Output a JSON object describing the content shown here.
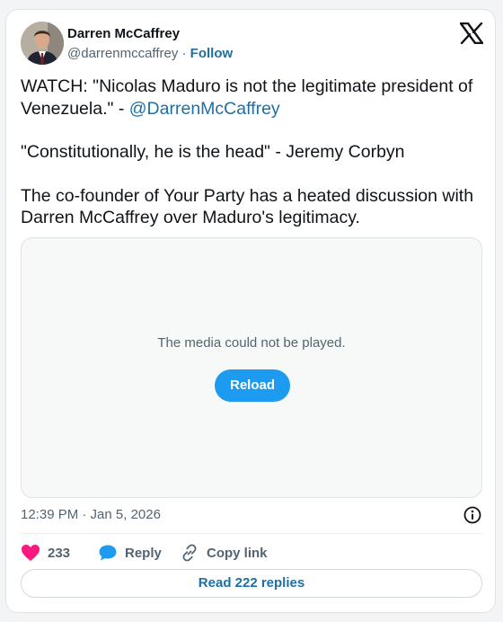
{
  "author": {
    "name": "Darren McCaffrey",
    "handle": "@darrenmccaffrey",
    "separator": " · ",
    "follow_label": "Follow"
  },
  "tweet": {
    "line1_text": "WATCH: \"Nicolas Maduro is not the legitimate president of Venezuela.\" - ",
    "mention": "@DarrenMcCaffrey",
    "paragraph2": "\"Constitutionally, he is the head\" - Jeremy Corbyn",
    "paragraph3": "The co-founder of Your Party has a heated discussion with Darren McCaffrey over Maduro's legitimacy."
  },
  "media": {
    "message": "The media could not be played.",
    "reload_label": "Reload"
  },
  "meta": {
    "timestamp": "12:39 PM · Jan 5, 2026"
  },
  "actions": {
    "like_count": "233",
    "reply_label": "Reply",
    "copy_link_label": "Copy link"
  },
  "footer": {
    "read_replies_label": "Read 222 replies"
  },
  "icons": {
    "logo": "x-logo-icon",
    "info": "info-icon",
    "like": "heart-icon",
    "reply": "speech-bubble-icon",
    "copy": "link-icon"
  },
  "colors": {
    "link": "#1d6fa5",
    "reload_button": "#1d9bf0",
    "like": "#f91880",
    "muted_text": "#536471"
  }
}
